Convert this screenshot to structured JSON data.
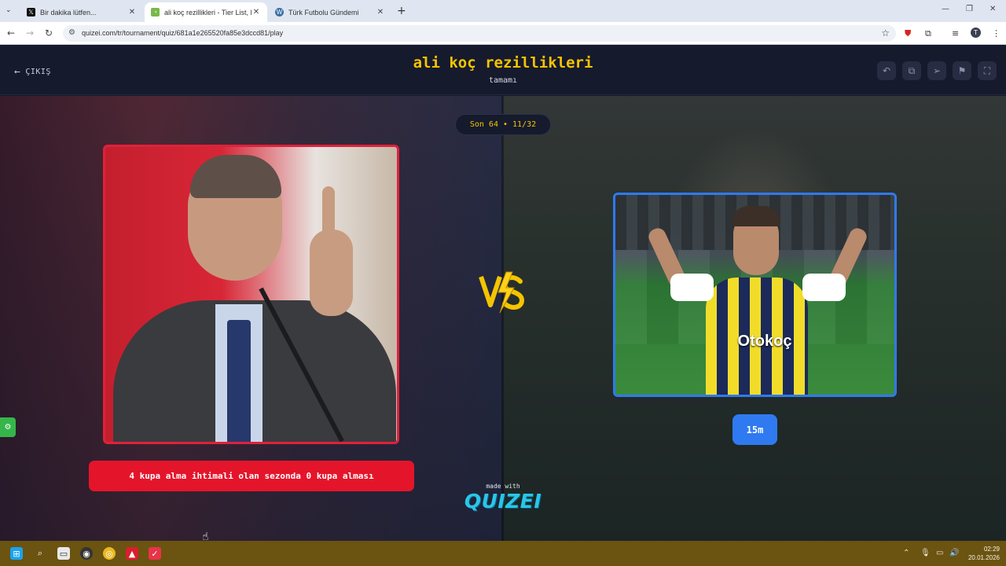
{
  "browser": {
    "tabs": [
      {
        "label": "Bir dakika lütfen...",
        "icon": "x-logo-icon",
        "active": false
      },
      {
        "label": "ali koç rezillikleri - Tier List, Kö",
        "icon": "quizei-favicon-icon",
        "active": true
      },
      {
        "label": "Türk Futbolu Gündemi",
        "icon": "wordpress-icon",
        "active": false
      }
    ],
    "url": "quizei.com/tr/tournament/quiz/681a1e265520fa85e3dccd81/play",
    "profile_initial": "T",
    "extension_badge": "2"
  },
  "header": {
    "exit_label": "ÇIKIŞ",
    "title": "ali koç rezillikleri",
    "subtitle": "tamamı",
    "actions": [
      "undo-icon",
      "copy-icon",
      "send-icon",
      "flag-icon",
      "fullscreen-icon"
    ]
  },
  "tournament": {
    "round_label": "Son 64 • 11/32",
    "left_choice": "4 kupa alma ihtimali olan sezonda 0 kupa alması",
    "right_choice": "15m",
    "vs_label": "VS",
    "made_with": "made with",
    "brand": "QUIZEI"
  },
  "colors": {
    "accent_yellow": "#f5c400",
    "left_red": "#e4152b",
    "right_blue": "#2f7af0",
    "brand_cyan": "#29c6e8",
    "background": "#161a2d"
  },
  "taskbar": {
    "time": "02:29",
    "date": "20.01.2026"
  }
}
